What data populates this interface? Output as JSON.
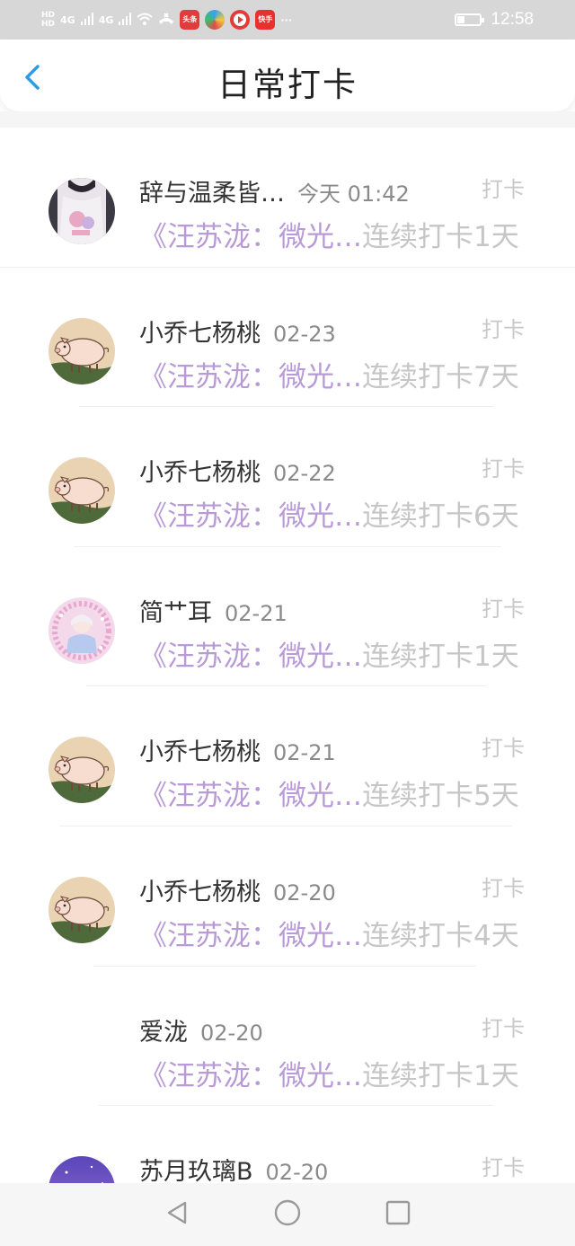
{
  "status_bar": {
    "hd1": "HD",
    "hd2": "HD",
    "signal1": "4G",
    "signal2": "4G",
    "app1": "头条",
    "app4": "快手",
    "more": "···",
    "time": "12:58",
    "battery_level": 0.35
  },
  "header": {
    "title": "日常打卡"
  },
  "items": [
    {
      "name": "辞与温柔皆…",
      "time": "今天 01:42",
      "action": "打卡",
      "book": "《汪苏泷：微光…",
      "streak": "连续打卡1天",
      "avatar": "girl-white"
    },
    {
      "name": "小乔七杨桃",
      "time": "02-23",
      "action": "打卡",
      "book": "《汪苏泷：微光…",
      "streak": "连续打卡7天",
      "avatar": "pig"
    },
    {
      "name": "小乔七杨桃",
      "time": "02-22",
      "action": "打卡",
      "book": "《汪苏泷：微光…",
      "streak": "连续打卡6天",
      "avatar": "pig"
    },
    {
      "name": "简艹耳",
      "time": "02-21",
      "action": "打卡",
      "book": "《汪苏泷：微光…",
      "streak": "连续打卡1天",
      "avatar": "girl-pink"
    },
    {
      "name": "小乔七杨桃",
      "time": "02-21",
      "action": "打卡",
      "book": "《汪苏泷：微光…",
      "streak": "连续打卡5天",
      "avatar": "pig"
    },
    {
      "name": "小乔七杨桃",
      "time": "02-20",
      "action": "打卡",
      "book": "《汪苏泷：微光…",
      "streak": "连续打卡4天",
      "avatar": "pig"
    },
    {
      "name": "爱泷",
      "time": "02-20",
      "action": "打卡",
      "book": "《汪苏泷：微光…",
      "streak": "连续打卡1天",
      "avatar": "none"
    },
    {
      "name": "苏月玖璃B",
      "time": "02-20",
      "action": "打卡",
      "book": "",
      "streak": "",
      "avatar": "purple-sky"
    }
  ],
  "colors": {
    "book_link": "#b89ad6",
    "streak": "#c6c6c6",
    "back_arrow": "#2f9be6"
  },
  "icons": {
    "back": "chevron-left-icon",
    "nav_back": "triangle-back-icon",
    "nav_home": "circle-home-icon",
    "nav_recent": "square-recent-icon"
  }
}
